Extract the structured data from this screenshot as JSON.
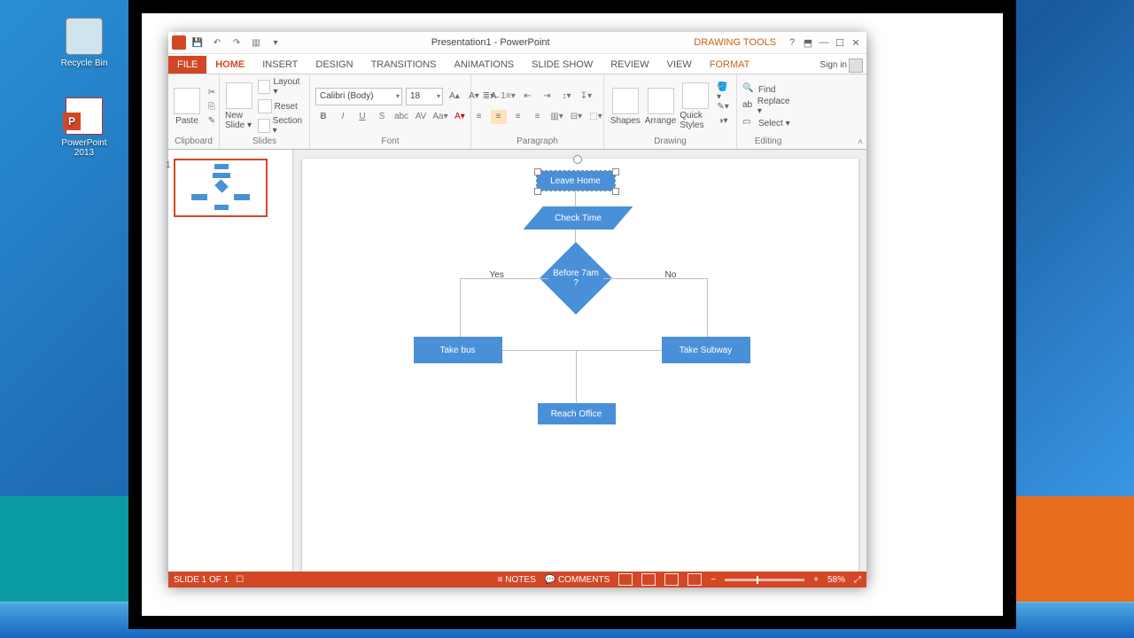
{
  "desktop": {
    "recycle_label": "Recycle Bin",
    "ppt_label": "PowerPoint 2013"
  },
  "title": {
    "document": "Presentation1 - PowerPoint",
    "context_tool": "DRAWING TOOLS",
    "signin": "Sign in"
  },
  "tabs": {
    "file": "FILE",
    "home": "HOME",
    "insert": "INSERT",
    "design": "DESIGN",
    "transitions": "TRANSITIONS",
    "animations": "ANIMATIONS",
    "slideshow": "SLIDE SHOW",
    "review": "REVIEW",
    "view": "VIEW",
    "format": "FORMAT"
  },
  "ribbon": {
    "clipboard": {
      "label": "Clipboard",
      "paste": "Paste"
    },
    "slides": {
      "label": "Slides",
      "new_slide": "New Slide ▾",
      "layout": "Layout ▾",
      "reset": "Reset",
      "section": "Section ▾"
    },
    "font": {
      "label": "Font",
      "name": "Calibri (Body)",
      "size": "18"
    },
    "paragraph": {
      "label": "Paragraph"
    },
    "drawing": {
      "label": "Drawing",
      "shapes": "Shapes",
      "arrange": "Arrange",
      "quick": "Quick Styles"
    },
    "editing": {
      "label": "Editing",
      "find": "Find",
      "replace": "Replace ▾",
      "select": "Select ▾"
    }
  },
  "thumbs": {
    "num": "1"
  },
  "flow": {
    "leave": "Leave Home",
    "check": "Check Time",
    "decision": "Before 7am ?",
    "yes": "Yes",
    "no": "No",
    "bus": "Take bus",
    "subway": "Take Subway",
    "office": "Reach Office"
  },
  "status": {
    "slide": "SLIDE 1 OF 1",
    "notes": "≡ NOTES",
    "comments": "💬 COMMENTS",
    "zoom": "58%"
  },
  "chart_data": {
    "type": "table",
    "diagram": "flowchart",
    "nodes": [
      {
        "id": "leave",
        "type": "process",
        "label": "Leave Home"
      },
      {
        "id": "check",
        "type": "data",
        "label": "Check Time"
      },
      {
        "id": "decide",
        "type": "decision",
        "label": "Before 7am ?"
      },
      {
        "id": "bus",
        "type": "process",
        "label": "Take bus"
      },
      {
        "id": "subway",
        "type": "process",
        "label": "Take Subway"
      },
      {
        "id": "office",
        "type": "process",
        "label": "Reach Office"
      }
    ],
    "edges": [
      {
        "from": "leave",
        "to": "check"
      },
      {
        "from": "check",
        "to": "decide"
      },
      {
        "from": "decide",
        "to": "bus",
        "label": "Yes"
      },
      {
        "from": "decide",
        "to": "subway",
        "label": "No"
      },
      {
        "from": "bus",
        "to": "office"
      },
      {
        "from": "subway",
        "to": "office"
      }
    ]
  }
}
